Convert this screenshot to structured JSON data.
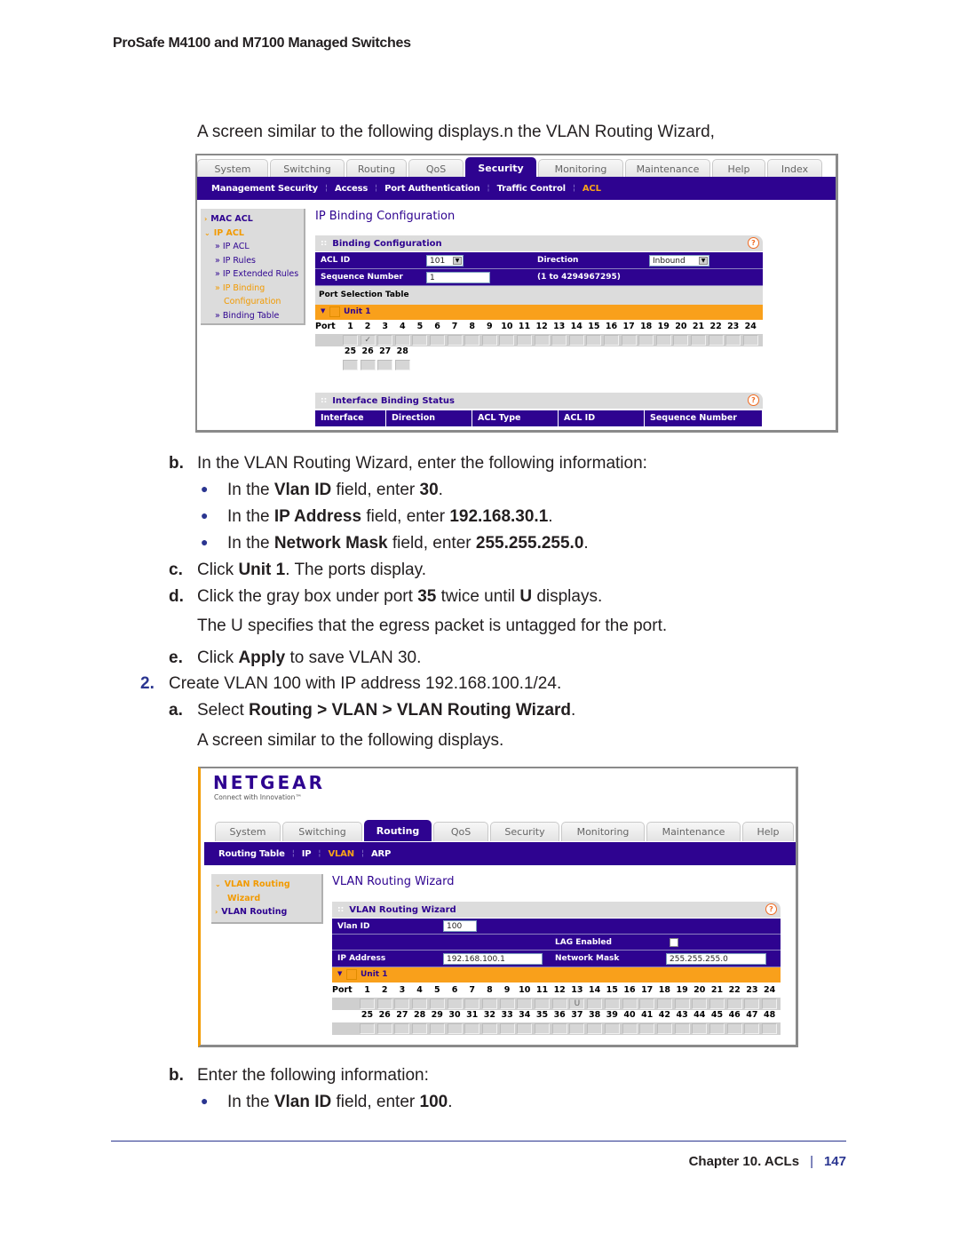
{
  "document": {
    "running_head": "ProSafe M4100 and M7100 Managed Switches",
    "intro": "A screen similar to the following displays.n the VLAN Routing Wizard,",
    "steps": {
      "b1": {
        "letter": "b.",
        "text": "In the VLAN Routing Wizard, enter the following information:"
      },
      "bullets1": [
        {
          "pre": "In the ",
          "bold": "Vlan ID",
          "mid": " field, enter ",
          "val": "30",
          "post": "."
        },
        {
          "pre": "In the ",
          "bold": "IP Address",
          "mid": " field, enter ",
          "val": "192.168.30.1",
          "post": "."
        },
        {
          "pre": "In the ",
          "bold": "Network Mask",
          "mid": " field, enter ",
          "val": "255.255.255.0",
          "post": "."
        }
      ],
      "c": {
        "letter": "c.",
        "pre": "Click ",
        "bold": "Unit 1",
        "post": ". The ports display."
      },
      "d": {
        "letter": "d.",
        "pre": "Click the gray box under port ",
        "bold": "35",
        "mid": " twice until ",
        "bold2": "U",
        "post": " displays."
      },
      "d_note": "The U specifies that the egress packet is untagged for the port.",
      "e": {
        "letter": "e.",
        "pre": "Click ",
        "bold": "Apply",
        "post": " to save VLAN 30."
      },
      "two": {
        "num": "2.",
        "text": "Create VLAN 100 with IP address 192.168.100.1/24."
      },
      "a": {
        "letter": "a.",
        "pre": "Select ",
        "bold": "Routing > VLAN > VLAN Routing Wizard",
        "post": "."
      },
      "a_note": "A screen similar to the following displays.",
      "b2": {
        "letter": "b.",
        "text": "Enter the following information:"
      },
      "bullets2": [
        {
          "pre": "In the ",
          "bold": "Vlan ID",
          "mid": " field, enter ",
          "val": "100",
          "post": "."
        }
      ]
    },
    "footer": {
      "chapter": "Chapter 10.  ACLs",
      "page": "147"
    }
  },
  "screenshot1": {
    "tabs": [
      "System",
      "Switching",
      "Routing",
      "QoS",
      "Security",
      "Monitoring",
      "Maintenance",
      "Help",
      "Index"
    ],
    "active_tab": "Security",
    "subnav": [
      "Management Security",
      "Access",
      "Port Authentication",
      "Traffic Control",
      "ACL"
    ],
    "active_subnav": "ACL",
    "leftnav": [
      {
        "label": "MAC ACL",
        "marker": ">"
      },
      {
        "label": "IP ACL",
        "marker": "v"
      },
      {
        "label": "» IP ACL"
      },
      {
        "label": "» IP Rules"
      },
      {
        "label": "» IP Extended Rules"
      },
      {
        "label": "» IP Binding"
      },
      {
        "label": "Configuration"
      },
      {
        "label": "» Binding Table"
      }
    ],
    "page_title": "IP Binding Configuration",
    "panel_title": "Binding Configuration",
    "acl_id_label": "ACL ID",
    "acl_id_value": "101",
    "direction_label": "Direction",
    "direction_value": "Inbound",
    "seq_label": "Sequence Number",
    "seq_value": "1",
    "seq_range": "(1 to 4294967295)",
    "port_table_label": "Port Selection Table",
    "unit_label": "Unit 1",
    "port_label": "Port",
    "ports_row1": [
      "1",
      "2",
      "3",
      "4",
      "5",
      "6",
      "7",
      "8",
      "9",
      "10",
      "11",
      "12",
      "13",
      "14",
      "15",
      "16",
      "17",
      "18",
      "19",
      "20",
      "21",
      "22",
      "23",
      "24"
    ],
    "ports_row2": [
      "25",
      "26",
      "27",
      "28"
    ],
    "checked_port": "2",
    "check_mark": "✓",
    "status_title": "Interface Binding Status",
    "status_columns": [
      "Interface",
      "Direction",
      "ACL Type",
      "ACL ID",
      "Sequence Number"
    ],
    "help_glyph": "?"
  },
  "screenshot2": {
    "logo": "NETGEAR",
    "tagline": "Connect with Innovation™",
    "tabs": [
      "System",
      "Switching",
      "Routing",
      "QoS",
      "Security",
      "Monitoring",
      "Maintenance",
      "Help"
    ],
    "active_tab": "Routing",
    "subnav": [
      "Routing Table",
      "IP",
      "VLAN",
      "ARP"
    ],
    "active_subnav": "VLAN",
    "leftnav": [
      {
        "label": "VLAN Routing",
        "marker": "v"
      },
      {
        "label": "Wizard"
      },
      {
        "label": "VLAN Routing",
        "marker": ">"
      }
    ],
    "page_title": "VLAN Routing Wizard",
    "panel_title": "VLAN Routing Wizard",
    "vlan_id_label": "Vlan ID",
    "vlan_id_value": "100",
    "lag_label": "LAG Enabled",
    "lag_checked": false,
    "ip_label": "IP Address",
    "ip_value": "192.168.100.1",
    "mask_label": "Network Mask",
    "mask_value": "255.255.255.0",
    "unit_label": "Unit 1",
    "port_label": "Port",
    "ports_row1": [
      "1",
      "2",
      "3",
      "4",
      "5",
      "6",
      "7",
      "8",
      "9",
      "10",
      "11",
      "12",
      "13",
      "14",
      "15",
      "16",
      "17",
      "18",
      "19",
      "20",
      "21",
      "22",
      "23",
      "24"
    ],
    "ports_row2": [
      "25",
      "26",
      "27",
      "28",
      "29",
      "30",
      "31",
      "32",
      "33",
      "34",
      "35",
      "36",
      "37",
      "38",
      "39",
      "40",
      "41",
      "42",
      "43",
      "44",
      "45",
      "46",
      "47",
      "48"
    ],
    "untagged_port": "13",
    "untagged_glyph": "U",
    "help_glyph": "?"
  }
}
